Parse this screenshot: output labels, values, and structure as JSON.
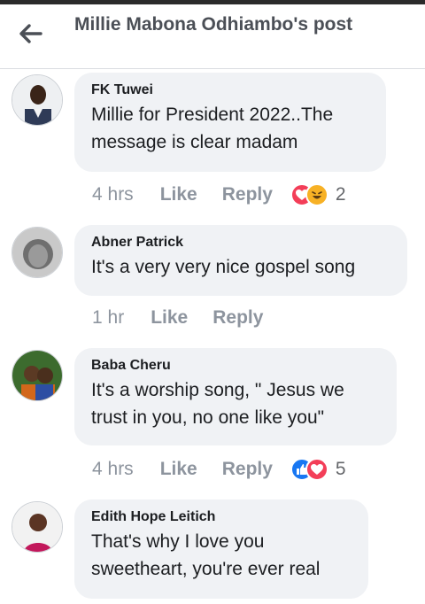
{
  "header": {
    "title": "Millie Mabona Odhiambo's post"
  },
  "comments": [
    {
      "author": "FK Tuwei",
      "text": "Millie for President 2022..The message is clear madam",
      "time": "4 hrs",
      "like_label": "Like",
      "reply_label": "Reply",
      "reactions": [
        "love",
        "haha"
      ],
      "reaction_count": "2"
    },
    {
      "author": "Abner Patrick",
      "text": "It's a very very nice gospel song",
      "time": "1 hr",
      "like_label": "Like",
      "reply_label": "Reply"
    },
    {
      "author": "Baba Cheru",
      "text": "It's a worship song, \" Jesus we trust in you, no one like you\"",
      "time": "4 hrs",
      "like_label": "Like",
      "reply_label": "Reply",
      "reactions": [
        "like",
        "love"
      ],
      "reaction_count": "5"
    },
    {
      "author": "Edith Hope Leitich",
      "text": "That's why I love you sweetheart, you're ever real"
    }
  ],
  "icons": {
    "back": "arrow-left-icon",
    "like_reaction": "thumbs-up-icon",
    "love_reaction": "heart-icon",
    "haha_reaction": "laughing-face-icon"
  },
  "colors": {
    "bubble_bg": "#f0f2f5",
    "meta_text": "#8d949e",
    "like_blue": "#1877f2",
    "love_red": "#f33e58",
    "haha_yellow": "#f7b125"
  }
}
